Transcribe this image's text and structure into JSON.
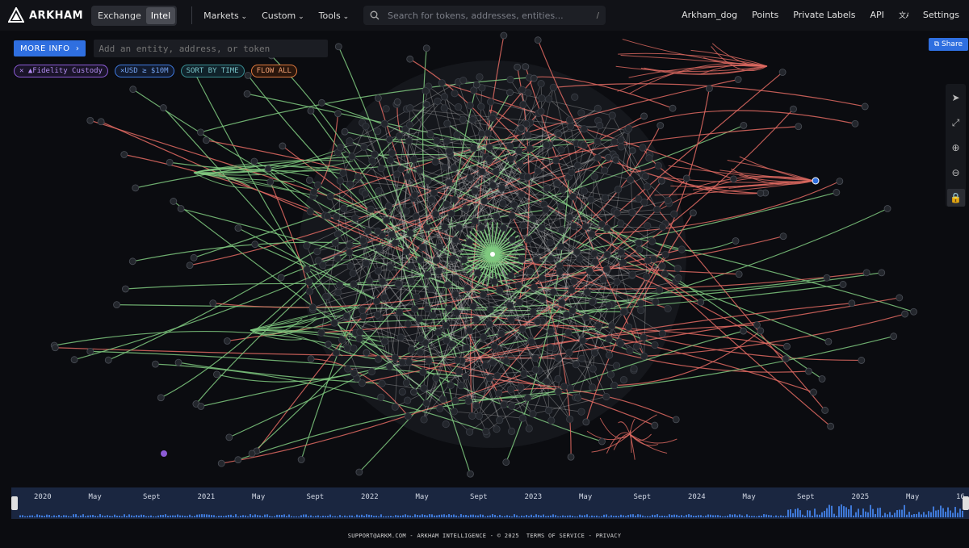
{
  "header": {
    "logo_text": "ARKHAM",
    "mode_tabs": [
      "Exchange",
      "Intel"
    ],
    "active_mode": "Intel",
    "menu": [
      "Markets",
      "Custom",
      "Tools"
    ],
    "search_placeholder": "Search for tokens, addresses, entities...",
    "search_shortcut": "/",
    "right_links": [
      "Arkham_dog",
      "Points",
      "Private Labels",
      "API",
      "Settings"
    ]
  },
  "toolbar": {
    "more_info": "MORE INFO",
    "entity_placeholder": "Add an entity, address, or token",
    "share": "Share"
  },
  "filters": [
    {
      "label": "Fidelity Custody",
      "color": "#8c5bd6"
    },
    {
      "label": "USD ≥ $10M",
      "color": "#3f7ae0"
    },
    {
      "label": "SORT BY TIME",
      "color": "#3a8f93"
    },
    {
      "label": "FLOW ALL",
      "color": "#e07a3f"
    }
  ],
  "timeline": {
    "labels": [
      "2020",
      "May",
      "Sept",
      "2021",
      "May",
      "Sept",
      "2022",
      "May",
      "Sept",
      "2023",
      "May",
      "Sept",
      "2024",
      "May",
      "Sept",
      "2025",
      "May",
      "16"
    ]
  },
  "footer": {
    "text": "SUPPORT@ARKM.COM - ARKHAM INTELLIGENCE - © 2025",
    "terms": "TERMS OF SERVICE",
    "privacy": "PRIVACY"
  },
  "colors": {
    "inflow": "#7fc97f",
    "outflow": "#e06a62",
    "internal": "#cfcfcf",
    "accent": "#2f6fe0"
  }
}
